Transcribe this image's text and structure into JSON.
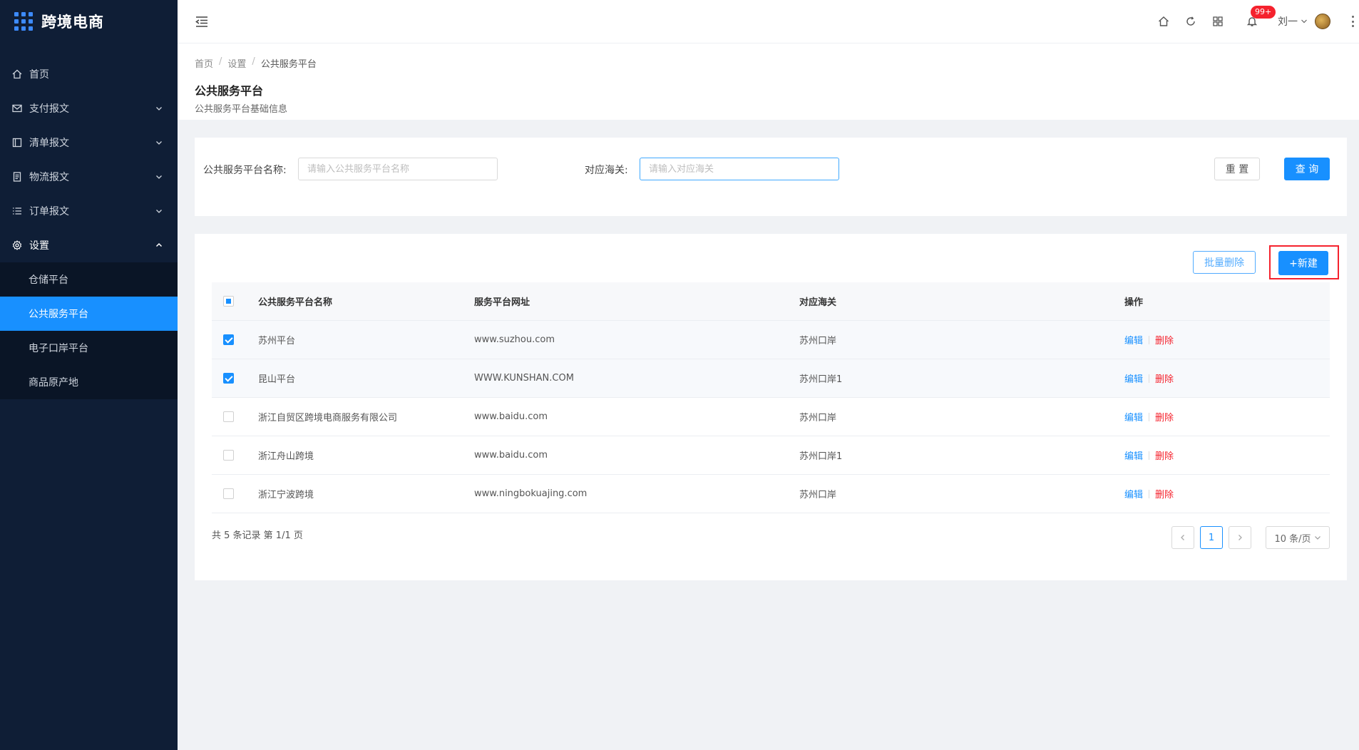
{
  "brand": {
    "title": "跨境电商"
  },
  "sidebar": {
    "items": [
      {
        "label": "首页",
        "icon": "home-icon"
      },
      {
        "label": "支付报文",
        "icon": "mail-icon"
      },
      {
        "label": "清单报文",
        "icon": "list-box-icon"
      },
      {
        "label": "物流报文",
        "icon": "document-icon"
      },
      {
        "label": "订单报文",
        "icon": "list-icon"
      },
      {
        "label": "设置",
        "icon": "gear-icon"
      }
    ],
    "submenu": [
      {
        "label": "仓储平台"
      },
      {
        "label": "公共服务平台"
      },
      {
        "label": "电子口岸平台"
      },
      {
        "label": "商品原产地"
      }
    ]
  },
  "header": {
    "badge": "99+",
    "user_name": "刘一"
  },
  "breadcrumb": {
    "home": "首页",
    "settings": "设置",
    "current": "公共服务平台",
    "sep": "/"
  },
  "page": {
    "title": "公共服务平台",
    "subtitle": "公共服务平台基础信息"
  },
  "search": {
    "name_label": "公共服务平台名称:",
    "name_placeholder": "请输入公共服务平台名称",
    "customs_label": "对应海关:",
    "customs_placeholder": "请输入对应海关",
    "reset_label": "重 置",
    "query_label": "查 询"
  },
  "toolbar": {
    "batch_delete_label": "批量删除",
    "new_label": "+新建"
  },
  "table": {
    "headers": {
      "name": "公共服务平台名称",
      "url": "服务平台网址",
      "customs": "对应海关",
      "ops": "操作"
    },
    "edit_label": "编辑",
    "delete_label": "删除",
    "rows": [
      {
        "name": "苏州平台",
        "url": "www.suzhou.com",
        "customs": "苏州口岸"
      },
      {
        "name": "昆山平台",
        "url": "WWW.KUNSHAN.COM",
        "customs": "苏州口岸1"
      },
      {
        "name": "浙江自贸区跨境电商服务有限公司",
        "url": "www.baidu.com",
        "customs": "苏州口岸"
      },
      {
        "name": "浙江舟山跨境",
        "url": "www.baidu.com",
        "customs": "苏州口岸1"
      },
      {
        "name": "浙江宁波跨境",
        "url": "www.ningbokuajing.com",
        "customs": "苏州口岸"
      }
    ]
  },
  "pagination": {
    "summary": "共 5 条记录 第 1/1 页",
    "current_page": "1",
    "page_size": "10 条/页"
  },
  "colors": {
    "primary": "#1890ff",
    "danger": "#f5222d",
    "sidebar_bg": "#0f1e36"
  }
}
